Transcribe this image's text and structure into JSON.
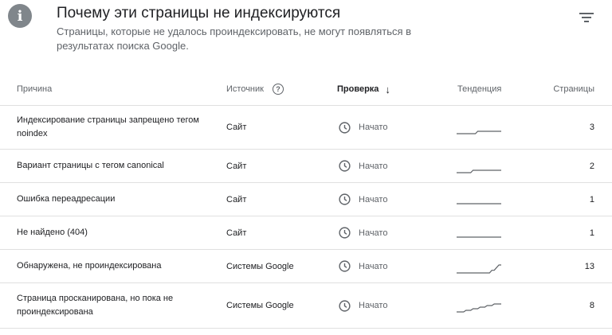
{
  "header": {
    "title": "Почему эти страницы не индексируются",
    "subtitle": "Страницы, которые не удалось проиндексировать, не могут появляться в результатах поиска Google."
  },
  "columns": {
    "reason": "Причина",
    "source": "Источник",
    "check": "Проверка",
    "trend": "Тенденция",
    "pages": "Страницы"
  },
  "rows": [
    {
      "reason": "Индексирование страницы запрещено тегом noindex",
      "source": "Сайт",
      "check": "Начато",
      "pages": "3",
      "trend": [
        0,
        0,
        0,
        0,
        0,
        0,
        0,
        0,
        0,
        1,
        1,
        1,
        1,
        1,
        1,
        1,
        1,
        1,
        1,
        1
      ]
    },
    {
      "reason": "Вариант страницы с тегом canonical",
      "source": "Сайт",
      "check": "Начато",
      "pages": "2",
      "trend": [
        0,
        0,
        0,
        0,
        0,
        0,
        0,
        1,
        1,
        1,
        1,
        1,
        1,
        1,
        1,
        1,
        1,
        1,
        1,
        1
      ]
    },
    {
      "reason": "Ошибка переадресации",
      "source": "Сайт",
      "check": "Начато",
      "pages": "1",
      "trend": [
        1,
        1,
        1,
        1,
        1,
        1,
        1,
        1,
        1,
        1,
        1,
        1,
        1,
        1,
        1,
        1,
        1,
        1,
        1,
        1
      ]
    },
    {
      "reason": "Не найдено (404)",
      "source": "Сайт",
      "check": "Начато",
      "pages": "1",
      "trend": [
        1,
        1,
        1,
        1,
        1,
        1,
        1,
        1,
        1,
        1,
        1,
        1,
        1,
        1,
        1,
        1,
        1,
        1,
        1,
        1
      ]
    },
    {
      "reason": "Обнаружена, не проиндексирована",
      "source": "Системы Google",
      "check": "Начато",
      "pages": "13",
      "trend": [
        0,
        0,
        0,
        0,
        0,
        0,
        0,
        0,
        0,
        0,
        0,
        0,
        0,
        0,
        0,
        1,
        1,
        2,
        3,
        3
      ]
    },
    {
      "reason": "Страница просканирована, но пока не проиндексирована",
      "source": "Системы Google",
      "check": "Начато",
      "pages": "8",
      "trend": [
        0,
        0,
        0,
        0,
        1,
        1,
        1,
        2,
        2,
        2,
        3,
        3,
        3,
        4,
        4,
        4,
        5,
        5,
        5,
        5
      ]
    }
  ]
}
